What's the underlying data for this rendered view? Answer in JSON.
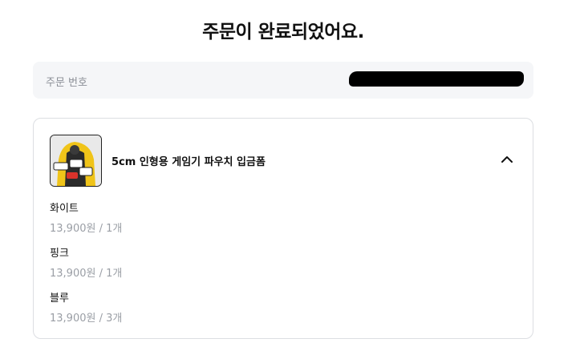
{
  "page": {
    "title": "주문이 완료되었어요."
  },
  "order": {
    "label": "주문 번호",
    "number": ""
  },
  "product": {
    "name": "5cm 인형용 게임기 파우치 입금폼",
    "thumbnail_icon": "product-photo",
    "toggle_icon": "chevron-up-icon"
  },
  "options": [
    {
      "name": "화이트",
      "price": "13,900원 / 1개"
    },
    {
      "name": "핑크",
      "price": "13,900원 / 1개"
    },
    {
      "name": "블루",
      "price": "13,900원 / 3개"
    }
  ]
}
